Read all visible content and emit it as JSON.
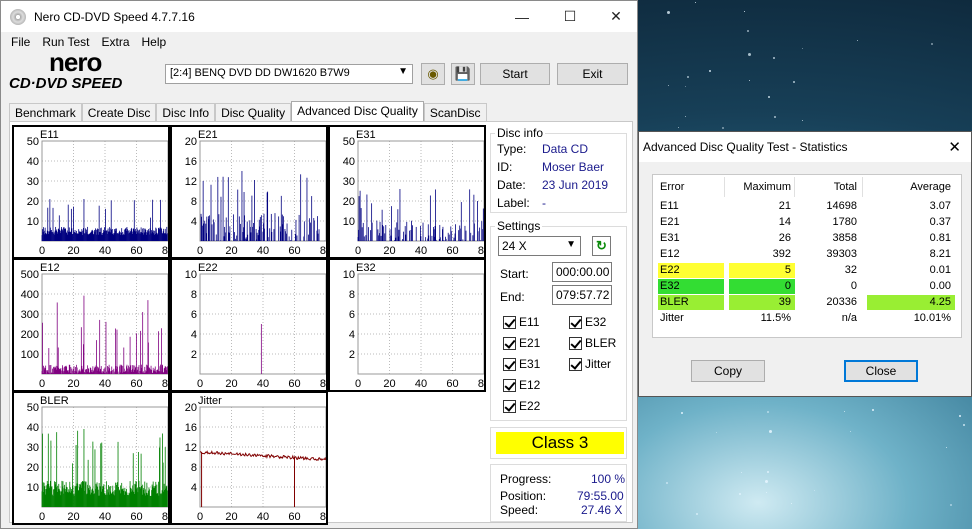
{
  "window": {
    "title": "Nero CD-DVD Speed 4.7.7.16"
  },
  "menu": [
    "File",
    "Run Test",
    "Extra",
    "Help"
  ],
  "logo": {
    "top": "nero",
    "bottom": "CD·DVD SPEED"
  },
  "drive": {
    "selected": "[2:4]  BENQ DVD DD DW1620 B7W9"
  },
  "toolbar": {
    "start_label": "Start",
    "exit_label": "Exit"
  },
  "tabs": [
    "Benchmark",
    "Create Disc",
    "Disc Info",
    "Disc Quality",
    "Advanced Disc Quality",
    "ScanDisc"
  ],
  "active_tab": "Advanced Disc Quality",
  "disc_info": {
    "label": "Disc info",
    "type_label": "Type:",
    "type": "Data CD",
    "id_label": "ID:",
    "id": "Moser Baer",
    "date_label": "Date:",
    "date": "23 Jun 2019",
    "disc_label_label": "Label:",
    "disc_label": "-"
  },
  "settings": {
    "label": "Settings",
    "speed": "24 X",
    "start_label": "Start:",
    "start": "000:00.00",
    "end_label": "End:",
    "end": "079:57.72",
    "checks": [
      "E11",
      "E32",
      "E21",
      "BLER",
      "E31",
      "Jitter",
      "E12",
      "E22"
    ]
  },
  "class_label": "Class 3",
  "progress": {
    "progress_label": "Progress:",
    "progress": "100 %",
    "position_label": "Position:",
    "position": "79:55.00",
    "speed_label": "Speed:",
    "speed": "27.46 X"
  },
  "chart_data": [
    {
      "type": "bar",
      "title": "E11",
      "ylim": [
        0,
        50
      ],
      "yticks": [
        10,
        20,
        30,
        40,
        50
      ],
      "xticks": [
        0,
        20,
        40,
        60,
        80
      ],
      "color": "#000080",
      "max": 21
    },
    {
      "type": "bar",
      "title": "E21",
      "ylim": [
        0,
        20
      ],
      "yticks": [
        4,
        8,
        12,
        16,
        20
      ],
      "xticks": [
        0,
        20,
        40,
        60,
        80
      ],
      "color": "#000080",
      "max": 14
    },
    {
      "type": "bar",
      "title": "E31",
      "ylim": [
        0,
        50
      ],
      "yticks": [
        10,
        20,
        30,
        40,
        50
      ],
      "xticks": [
        0,
        20,
        40,
        60,
        80
      ],
      "color": "#000080",
      "max": 26
    },
    {
      "type": "bar",
      "title": "E12",
      "ylim": [
        0,
        500
      ],
      "yticks": [
        100,
        200,
        300,
        400,
        500
      ],
      "xticks": [
        0,
        20,
        40,
        60,
        80
      ],
      "color": "#800080",
      "max": 392
    },
    {
      "type": "bar",
      "title": "E22",
      "ylim": [
        0,
        10
      ],
      "yticks": [
        2,
        4,
        6,
        8,
        10
      ],
      "xticks": [
        0,
        20,
        40,
        60,
        80
      ],
      "color": "#800080",
      "max": 5
    },
    {
      "type": "bar",
      "title": "E32",
      "ylim": [
        0,
        10
      ],
      "yticks": [
        2,
        4,
        6,
        8,
        10
      ],
      "xticks": [
        0,
        20,
        40,
        60,
        80
      ],
      "color": "#800080",
      "max": 0
    },
    {
      "type": "bar",
      "title": "BLER",
      "ylim": [
        0,
        50
      ],
      "yticks": [
        10,
        20,
        30,
        40,
        50
      ],
      "xticks": [
        0,
        20,
        40,
        60,
        80
      ],
      "color": "#008000",
      "max": 39
    },
    {
      "type": "line",
      "title": "Jitter",
      "ylim": [
        0,
        20
      ],
      "yticks": [
        4,
        8,
        12,
        16,
        20
      ],
      "xticks": [
        0,
        20,
        40,
        60,
        80
      ],
      "color": "#800000",
      "start": 11.0,
      "end": 9.5
    }
  ],
  "stats": {
    "title": "Advanced Disc Quality Test - Statistics",
    "headers": [
      "Error",
      "Maximum",
      "Total",
      "Average"
    ],
    "rows": [
      {
        "name": "E11",
        "max": "21",
        "total": "14698",
        "avg": "3.07",
        "hl": ""
      },
      {
        "name": "E21",
        "max": "14",
        "total": "1780",
        "avg": "0.37",
        "hl": ""
      },
      {
        "name": "E31",
        "max": "26",
        "total": "3858",
        "avg": "0.81",
        "hl": ""
      },
      {
        "name": "E12",
        "max": "392",
        "total": "39303",
        "avg": "8.21",
        "hl": ""
      },
      {
        "name": "E22",
        "max": "5",
        "total": "32",
        "avg": "0.01",
        "hl": "#ffff33"
      },
      {
        "name": "E32",
        "max": "0",
        "total": "0",
        "avg": "0.00",
        "hl": "#33dd33"
      },
      {
        "name": "BLER",
        "max": "39",
        "total": "20336",
        "avg": "4.25",
        "hl": "#99ee33"
      },
      {
        "name": "Jitter",
        "max": "11.5%",
        "total": "n/a",
        "avg": "10.01%",
        "hl": ""
      }
    ],
    "copy_label": "Copy",
    "close_label": "Close"
  }
}
